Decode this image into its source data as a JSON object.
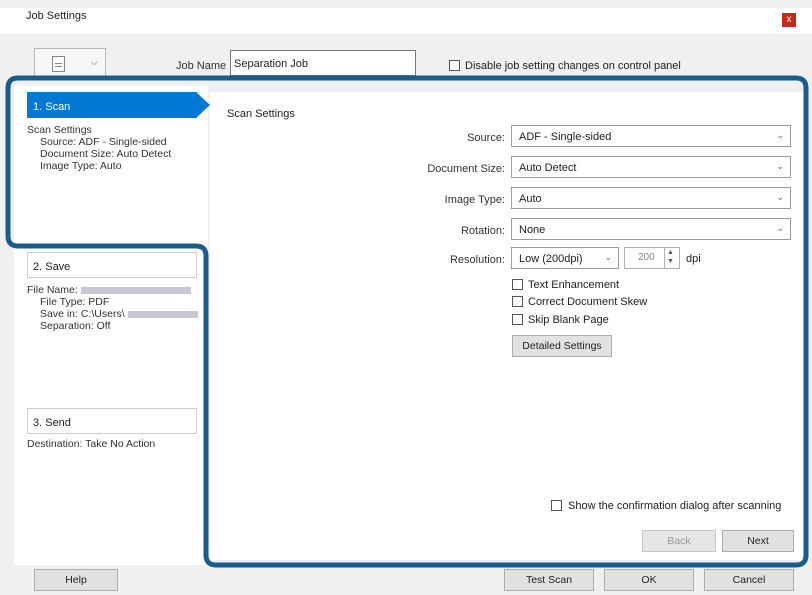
{
  "window": {
    "title": "Job Settings",
    "close_glyph": "x"
  },
  "job": {
    "name_label": "Job Name",
    "name_value": "Separation Job",
    "disable_label": "Disable job setting changes on control panel",
    "icon": "document-icon"
  },
  "nav": {
    "scan": {
      "header": "1. Scan",
      "lines": [
        "Scan Settings",
        "Source: ADF - Single-sided",
        "Document Size: Auto Detect",
        "Image Type: Auto"
      ]
    },
    "save": {
      "header": "2. Save",
      "file_name_label": "File Name:",
      "file_type": "File Type: PDF",
      "save_in_label": "Save in: C:\\Users\\",
      "separation": "Separation: Off"
    },
    "send": {
      "header": "3. Send",
      "destination": "Destination: Take No Action"
    }
  },
  "scan_settings": {
    "title": "Scan Settings",
    "source": {
      "label": "Source:",
      "value": "ADF - Single-sided"
    },
    "document_size": {
      "label": "Document Size:",
      "value": "Auto Detect"
    },
    "image_type": {
      "label": "Image Type:",
      "value": "Auto"
    },
    "rotation": {
      "label": "Rotation:",
      "value": "None"
    },
    "resolution": {
      "label": "Resolution:",
      "value": "Low (200dpi)",
      "dpi": "200",
      "unit": "dpi"
    },
    "text_enhancement": "Text Enhancement",
    "correct_skew": "Correct Document Skew",
    "skip_blank": "Skip Blank Page",
    "detailed_button": "Detailed Settings",
    "confirm_dialog": "Show the confirmation dialog after scanning"
  },
  "buttons": {
    "back": "Back",
    "next": "Next",
    "help": "Help",
    "test_scan": "Test Scan",
    "ok": "OK",
    "cancel": "Cancel"
  },
  "colors": {
    "accent": "#0078d4",
    "highlight": "#1a5d8c"
  }
}
